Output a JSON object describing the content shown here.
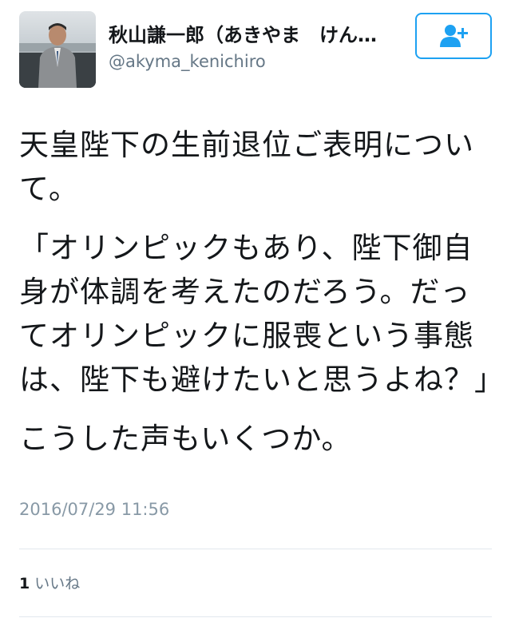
{
  "user": {
    "display_name": "秋山謙一郎（あきやま　けん…",
    "screen_name": "@akyma_kenichiro",
    "avatar_icon": "profile-photo",
    "follow_icon": "add-user-icon"
  },
  "tweet": {
    "paragraphs": [
      "天皇陛下の生前退位ご表明について。",
      "「オリンピックもあり、陛下御自身が体調を考えたのだろう。だってオリンピックに服喪という事態は、陛下も避けたいと思うよね？」",
      "こうした声もいくつか。"
    ],
    "timestamp": "2016/07/29 11:56"
  },
  "stats": {
    "likes_count": "1",
    "likes_label": "いいね"
  },
  "colors": {
    "accent": "#1da1f2",
    "text": "#14171a",
    "muted": "#657786",
    "divider": "#e1e8ed"
  }
}
